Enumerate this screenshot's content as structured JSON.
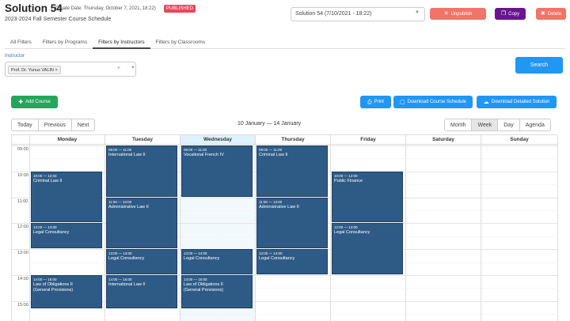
{
  "header": {
    "title": "Solution 54",
    "create_date": "(Create Date: Thursday, October 7, 2021, 18:22)",
    "status_badge": "PUBLISHED",
    "subtitle": "2023-2024 Fall Semester Course Schedule",
    "solution_select_value": "Solution 54 (7/10/2021 - 18:22)",
    "unpublish_label": "Unpublish",
    "copy_label": "Copy",
    "delete_label": "Delete"
  },
  "tabs": [
    {
      "label": "All Filters"
    },
    {
      "label": "Filters by Programs"
    },
    {
      "label": "Filters by Instructors",
      "active": true
    },
    {
      "label": "Filters by Classrooms"
    }
  ],
  "filter": {
    "instructor_label": "Instructor",
    "instructor_tag": "Prof. Dr. Yunus VALIN"
  },
  "search_label": "Search",
  "actions": {
    "add_course": "Add Course",
    "print": "Print",
    "download_schedule": "Download Course Schedule",
    "download_solution": "Download Detailed Solution"
  },
  "calendar": {
    "nav": {
      "today": "Today",
      "previous": "Previous",
      "next": "Next"
    },
    "range": "10 January — 14 January",
    "views": {
      "month": "Month",
      "week": "Week",
      "day": "Day",
      "agenda": "Agenda"
    },
    "active_view": "Week",
    "days": [
      "Monday",
      "Tuesday",
      "Wednesday",
      "Thursday",
      "Friday",
      "Saturday",
      "Sunday"
    ],
    "today_index": 2,
    "hours": [
      "09:00",
      "10:00",
      "11:00",
      "12:00",
      "13:00",
      "14:00",
      "15:00"
    ],
    "events": [
      {
        "day": 0,
        "start": 10,
        "end": 12,
        "time": "10:00 — 12:00",
        "title": "Criminal Law II"
      },
      {
        "day": 0,
        "start": 12,
        "end": 13,
        "time": "12:00 — 13:00",
        "title": "Legal Consultancy"
      },
      {
        "day": 0,
        "start": 14,
        "end": 15.3,
        "time": "14:00 — 16:00",
        "title": "Law of Obligations II\n(General Provisions)"
      },
      {
        "day": 1,
        "start": 9,
        "end": 11,
        "time": "09:00 — 11:00",
        "title": "International Law II"
      },
      {
        "day": 1,
        "start": 11,
        "end": 13,
        "time": "11:00 — 13:00",
        "title": "Administrative Law II"
      },
      {
        "day": 1,
        "start": 13,
        "end": 14,
        "time": "13:00 — 14:00",
        "title": "Legal Consultancy"
      },
      {
        "day": 1,
        "start": 14,
        "end": 15.3,
        "time": "14:00 — 16:00",
        "title": "International Law II"
      },
      {
        "day": 2,
        "start": 9,
        "end": 11,
        "time": "09:00 — 11:00",
        "title": "Vocational French IV"
      },
      {
        "day": 2,
        "start": 13,
        "end": 14,
        "time": "13:00 — 14:00",
        "title": "Legal Consultancy"
      },
      {
        "day": 2,
        "start": 14,
        "end": 15.3,
        "time": "14:00 — 16:00",
        "title": "Law of Obligations II\n(General Provisions)"
      },
      {
        "day": 3,
        "start": 9,
        "end": 11,
        "time": "09:00 — 11:00",
        "title": "Criminal Law II"
      },
      {
        "day": 3,
        "start": 11,
        "end": 13,
        "time": "11:00 — 13:00",
        "title": "Administrative Law II"
      },
      {
        "day": 3,
        "start": 13,
        "end": 14,
        "time": "13:00 — 14:00",
        "title": "Legal Consultancy"
      },
      {
        "day": 4,
        "start": 10,
        "end": 12,
        "time": "10:00 — 12:00",
        "title": "Public Finance"
      },
      {
        "day": 4,
        "start": 12,
        "end": 14,
        "time": "12:00 — 14:00",
        "title": "Legal Consultancy"
      }
    ]
  },
  "colors": {
    "event": "#2e5b86",
    "primary": "#2196f3",
    "danger": "#f27468",
    "purple": "#6a148f",
    "success": "#25a55a",
    "published": "#e8475b"
  }
}
